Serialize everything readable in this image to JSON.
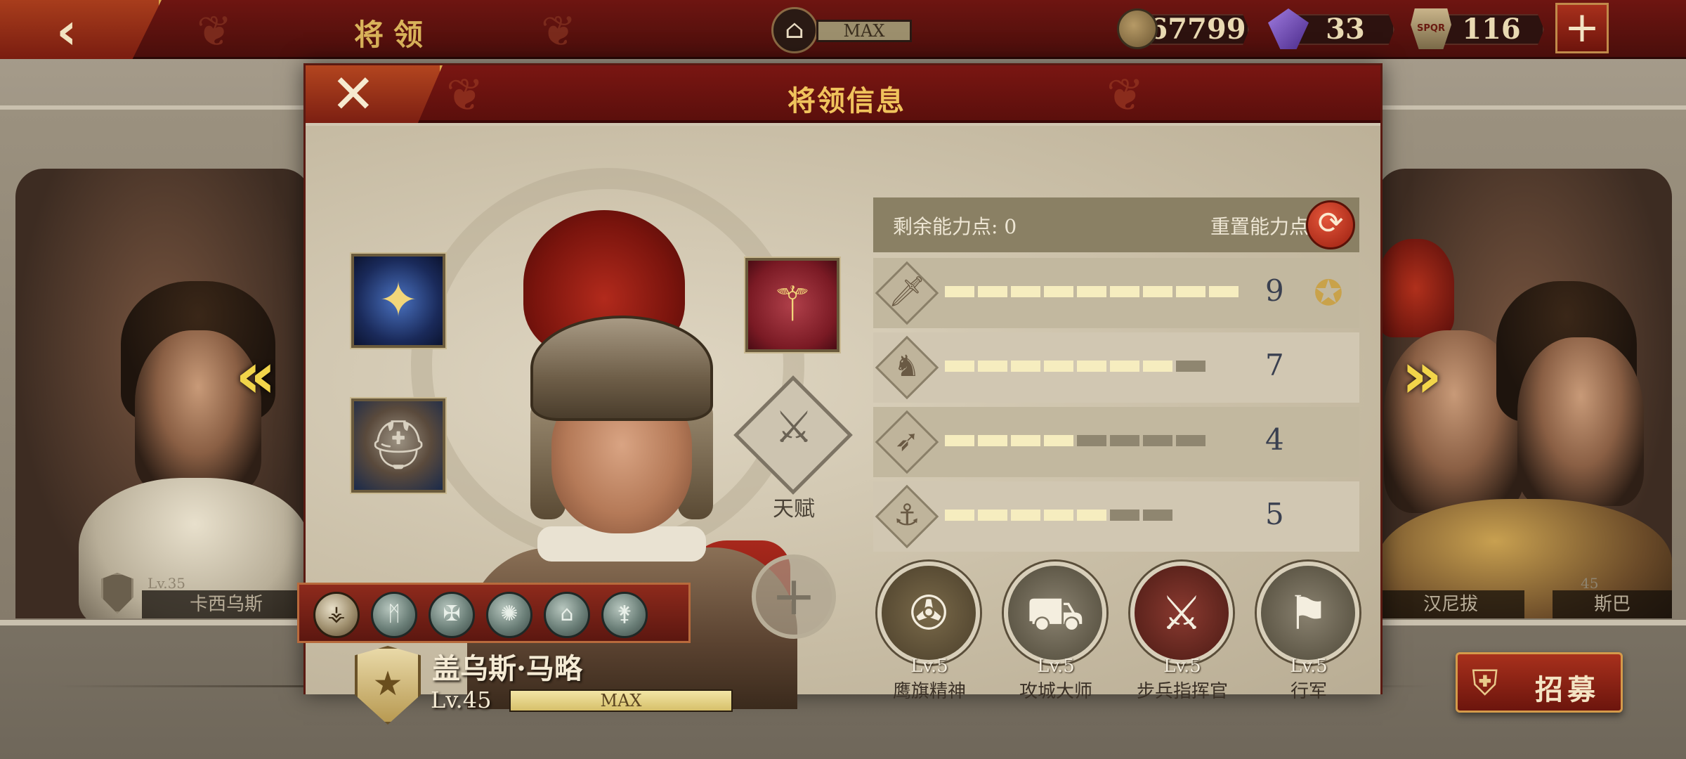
{
  "topbar": {
    "title": "将领",
    "max_label": "MAX",
    "coins": "67799",
    "gems": "33",
    "spqr_count": "116",
    "spqr_icon_text": "SPQR"
  },
  "background": {
    "left_general_name": "卡西乌斯",
    "left_general_level": "Lv.35",
    "right_general_name": "汉尼拔",
    "right2_general_name": "斯巴",
    "right2_general_level": "45"
  },
  "modal": {
    "title": "将领信息",
    "talent_label": "天赋",
    "general": {
      "name": "盖乌斯·马略",
      "level": "Lv.45",
      "xp_label": "MAX",
      "xp_fraction": 1.0
    },
    "stats": {
      "remaining_points_label": "剩余能力点: 0",
      "reset_label": "重置能力点",
      "rows": [
        {
          "icon": "sword-icon",
          "value": "9",
          "filled": 9,
          "total": 9,
          "starred": true
        },
        {
          "icon": "horse-icon",
          "value": "7",
          "filled": 7,
          "total": 8,
          "starred": false
        },
        {
          "icon": "bow-icon",
          "value": "4",
          "filled": 4,
          "total": 8,
          "starred": false
        },
        {
          "icon": "anchor-icon",
          "value": "5",
          "filled": 5,
          "total": 7,
          "starred": false
        }
      ]
    },
    "skills": [
      {
        "level": "Lv.5",
        "name": "鹰旗精神",
        "icon": "eagle-standard-icon"
      },
      {
        "level": "Lv.5",
        "name": "攻城大师",
        "icon": "siege-engine-icon"
      },
      {
        "level": "Lv.5",
        "name": "步兵指挥官",
        "icon": "crossed-swords-icon"
      },
      {
        "level": "Lv.5",
        "name": "行军",
        "icon": "marching-soldiers-icon"
      }
    ]
  },
  "recruit_label": "招募",
  "colors": {
    "header_red": "#6e1511",
    "gold_text": "#f0c35c",
    "stat_bar_on": "#f6edbf",
    "stat_bar_off": "#8f8670"
  }
}
